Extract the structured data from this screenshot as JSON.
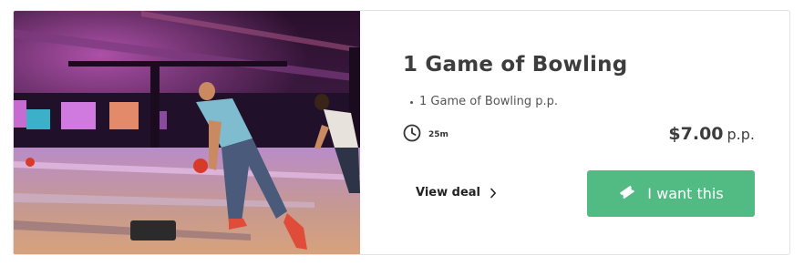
{
  "deal": {
    "title": "1 Game of Bowling",
    "features": [
      "1 Game of Bowling p.p."
    ],
    "duration": "25m",
    "price": "$7.00",
    "price_unit": "p.p.",
    "view_deal_label": "View deal",
    "cta_label": "I want this"
  },
  "icons": {
    "duration": "clock-icon",
    "view_deal": "chevron-right-icon",
    "cta": "ticket-icon"
  },
  "colors": {
    "cta_background": "#52bb84",
    "title_text": "#3d3d3d"
  }
}
